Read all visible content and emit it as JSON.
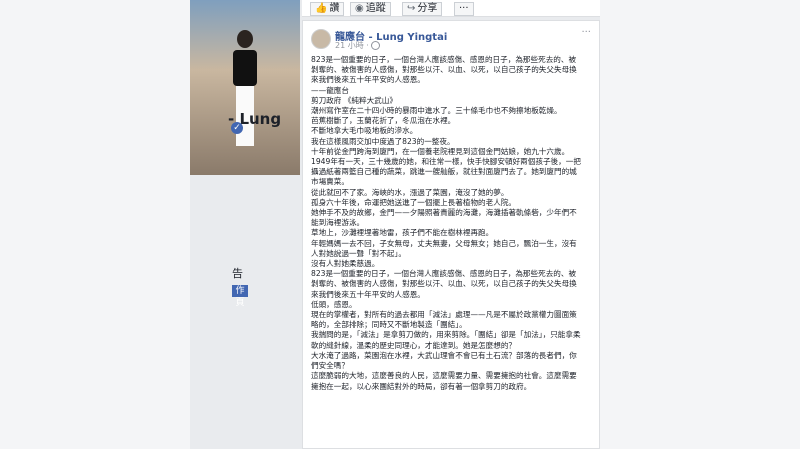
{
  "page": {
    "name_fragment": "- Lung",
    "left_text": "告",
    "left_button": "作頁"
  },
  "actions": {
    "like": "讚",
    "follow": "追蹤",
    "share": "分享"
  },
  "post": {
    "author": "龍應台 - Lung Yingtai",
    "time": "21 小時 ·",
    "paragraphs": [
      "823是一個重要的日子，一個台灣人應該感傷、感恩的日子，為那些死去的、被剝奪的、被傷害的人感傷，對那些以汗、以血、以死，以自己孩子的失父失母換來我們後來五十年平安的人感恩。",
      "——龍應台",
      "剪刀政府 《純粹大武山》",
      "潮州寫作室在二十四小時的暴雨中進水了。三十條毛巾也不夠擦地板乾燥。",
      "芭蕉樹斷了，玉蘭花折了，冬瓜泡在水裡。",
      "不斷地拿大毛巾吸地板的滲水。",
      "我在這樣風雨交加中度過了823的一整夜。",
      "十年前從金門跨海到廈門，在一個養老院裡見到這個金門姑娘，她九十六歲。",
      "1949年有一天，三十幾歲的她，和往常一樣，快手快腳安頓好兩個孩子後，一把攝過紙著兩籃自己種的蔬菜，跳進一艘舢舨，就往對面廈門去了。她到廈門的城市場賣菜。",
      "從此就回不了家。海峽的水，漲過了菜園，淹沒了她的夢。",
      "孤身六十年後，命運把她送進了一個擺上長著植物的老人院。",
      "她伸手不及的故鄉，金門——夕陽照著貴麗的海灘，海灘插著軌條砦，少年們不能到海裡游泳。",
      "草地上，沙灘裡埋著地雷，孩子們不能在樹林裡再跑。",
      "年輕媽媽一去不回，子女無母，丈夫無妻，父母無女；她自己，飄泊一生，沒有人對她說過一聲「對不起」。",
      "沒有人對她柔慈過。",
      "823是一個重要的日子，一個台灣人應該感傷、感恩的日子，為那些死去的、被剝奪的、被傷害的人感傷，對那些以汗、以血、以死，以自己孩子的失父失母換來我們後來五十年平安的人感恩。",
      "低頭，感恩。",
      "現在的掌權者，對所有的過去都用「減法」處理——凡是不屬於政黨權力圖面策略的，全部排除；同時又不斷地製造「團結」。",
      "我揣問的是，「減法」是拿剪刀做的，用來剪除。「團結」卻是「加法」，只能拿柔軟的縫針線，溫柔的歷史同理心，才能達到。她是怎麼想的？",
      "大水淹了過路，菜園泡在水裡，大武山理會不會已有土石流？部落的長者們，你們安全嗎？",
      "這麼脆弱的大地，這麼善良的人民，這麼需要力量、需要擁抱的社會。這麼需要擁抱在一起，以心來團結對外的時局，卻有著一個拿剪刀的政府。"
    ]
  }
}
